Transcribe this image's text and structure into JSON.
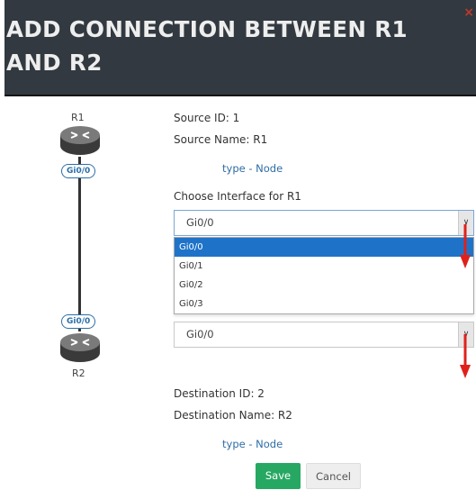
{
  "dialog": {
    "title_line1": "ADD CONNECTION BETWEEN R1",
    "title_line2": "AND R2",
    "close": "×"
  },
  "topology": {
    "source_node": "R1",
    "dest_node": "R2",
    "source_iface": "Gi0/0",
    "dest_iface": "Gi0/0"
  },
  "source": {
    "id_label": "Source ID: 1",
    "name_label": "Source Name: R1",
    "type_link": "type - Node",
    "choose_label": "Choose Interface for R1",
    "selected_value": "Gi0/0",
    "options": [
      "Gi0/0",
      "Gi0/1",
      "Gi0/2",
      "Gi0/3"
    ],
    "highlighted_option": "Gi0/0"
  },
  "destination": {
    "selected_value": "Gi0/0",
    "id_label": "Destination ID: 2",
    "name_label": "Destination Name: R2",
    "type_link": "type - Node"
  },
  "buttons": {
    "save": "Save",
    "cancel": "Cancel"
  },
  "colors": {
    "header_bg": "#323940",
    "save_bg": "#27a862",
    "highlight": "#1e73c9",
    "link": "#2e6da4",
    "annotation_arrow": "#e0201b",
    "close": "#c0392b"
  },
  "icons": [
    "router-icon",
    "chevron-down-icon",
    "close-icon",
    "red-down-arrow-icon"
  ]
}
